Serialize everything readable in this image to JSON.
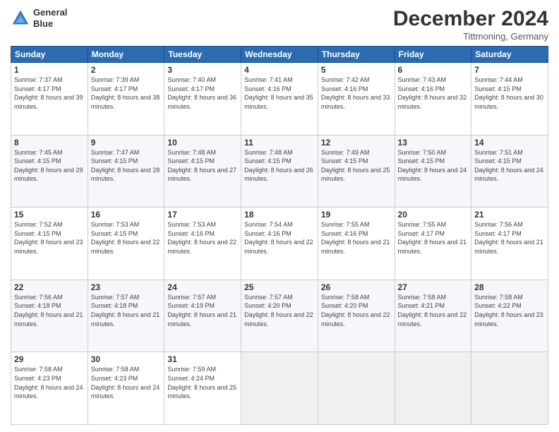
{
  "header": {
    "logo_line1": "General",
    "logo_line2": "Blue",
    "month": "December 2024",
    "location": "Tittmoning, Germany"
  },
  "days_of_week": [
    "Sunday",
    "Monday",
    "Tuesday",
    "Wednesday",
    "Thursday",
    "Friday",
    "Saturday"
  ],
  "weeks": [
    [
      {
        "day": 1,
        "sunrise": "7:37 AM",
        "sunset": "4:17 PM",
        "daylight": "8 hours and 39 minutes."
      },
      {
        "day": 2,
        "sunrise": "7:39 AM",
        "sunset": "4:17 PM",
        "daylight": "8 hours and 38 minutes."
      },
      {
        "day": 3,
        "sunrise": "7:40 AM",
        "sunset": "4:17 PM",
        "daylight": "8 hours and 36 minutes."
      },
      {
        "day": 4,
        "sunrise": "7:41 AM",
        "sunset": "4:16 PM",
        "daylight": "8 hours and 35 minutes."
      },
      {
        "day": 5,
        "sunrise": "7:42 AM",
        "sunset": "4:16 PM",
        "daylight": "8 hours and 33 minutes."
      },
      {
        "day": 6,
        "sunrise": "7:43 AM",
        "sunset": "4:16 PM",
        "daylight": "8 hours and 32 minutes."
      },
      {
        "day": 7,
        "sunrise": "7:44 AM",
        "sunset": "4:15 PM",
        "daylight": "8 hours and 30 minutes."
      }
    ],
    [
      {
        "day": 8,
        "sunrise": "7:45 AM",
        "sunset": "4:15 PM",
        "daylight": "8 hours and 29 minutes."
      },
      {
        "day": 9,
        "sunrise": "7:47 AM",
        "sunset": "4:15 PM",
        "daylight": "8 hours and 28 minutes."
      },
      {
        "day": 10,
        "sunrise": "7:48 AM",
        "sunset": "4:15 PM",
        "daylight": "8 hours and 27 minutes."
      },
      {
        "day": 11,
        "sunrise": "7:48 AM",
        "sunset": "4:15 PM",
        "daylight": "8 hours and 26 minutes."
      },
      {
        "day": 12,
        "sunrise": "7:49 AM",
        "sunset": "4:15 PM",
        "daylight": "8 hours and 25 minutes."
      },
      {
        "day": 13,
        "sunrise": "7:50 AM",
        "sunset": "4:15 PM",
        "daylight": "8 hours and 24 minutes."
      },
      {
        "day": 14,
        "sunrise": "7:51 AM",
        "sunset": "4:15 PM",
        "daylight": "8 hours and 24 minutes."
      }
    ],
    [
      {
        "day": 15,
        "sunrise": "7:52 AM",
        "sunset": "4:15 PM",
        "daylight": "8 hours and 23 minutes."
      },
      {
        "day": 16,
        "sunrise": "7:53 AM",
        "sunset": "4:15 PM",
        "daylight": "8 hours and 22 minutes."
      },
      {
        "day": 17,
        "sunrise": "7:53 AM",
        "sunset": "4:16 PM",
        "daylight": "8 hours and 22 minutes."
      },
      {
        "day": 18,
        "sunrise": "7:54 AM",
        "sunset": "4:16 PM",
        "daylight": "8 hours and 22 minutes."
      },
      {
        "day": 19,
        "sunrise": "7:55 AM",
        "sunset": "4:16 PM",
        "daylight": "8 hours and 21 minutes."
      },
      {
        "day": 20,
        "sunrise": "7:55 AM",
        "sunset": "4:17 PM",
        "daylight": "8 hours and 21 minutes."
      },
      {
        "day": 21,
        "sunrise": "7:56 AM",
        "sunset": "4:17 PM",
        "daylight": "8 hours and 21 minutes."
      }
    ],
    [
      {
        "day": 22,
        "sunrise": "7:56 AM",
        "sunset": "4:18 PM",
        "daylight": "8 hours and 21 minutes."
      },
      {
        "day": 23,
        "sunrise": "7:57 AM",
        "sunset": "4:18 PM",
        "daylight": "8 hours and 21 minutes."
      },
      {
        "day": 24,
        "sunrise": "7:57 AM",
        "sunset": "4:19 PM",
        "daylight": "8 hours and 21 minutes."
      },
      {
        "day": 25,
        "sunrise": "7:57 AM",
        "sunset": "4:20 PM",
        "daylight": "8 hours and 22 minutes."
      },
      {
        "day": 26,
        "sunrise": "7:58 AM",
        "sunset": "4:20 PM",
        "daylight": "8 hours and 22 minutes."
      },
      {
        "day": 27,
        "sunrise": "7:58 AM",
        "sunset": "4:21 PM",
        "daylight": "8 hours and 22 minutes."
      },
      {
        "day": 28,
        "sunrise": "7:58 AM",
        "sunset": "4:22 PM",
        "daylight": "8 hours and 23 minutes."
      }
    ],
    [
      {
        "day": 29,
        "sunrise": "7:58 AM",
        "sunset": "4:23 PM",
        "daylight": "8 hours and 24 minutes."
      },
      {
        "day": 30,
        "sunrise": "7:58 AM",
        "sunset": "4:23 PM",
        "daylight": "8 hours and 24 minutes."
      },
      {
        "day": 31,
        "sunrise": "7:59 AM",
        "sunset": "4:24 PM",
        "daylight": "8 hours and 25 minutes."
      },
      null,
      null,
      null,
      null
    ]
  ]
}
